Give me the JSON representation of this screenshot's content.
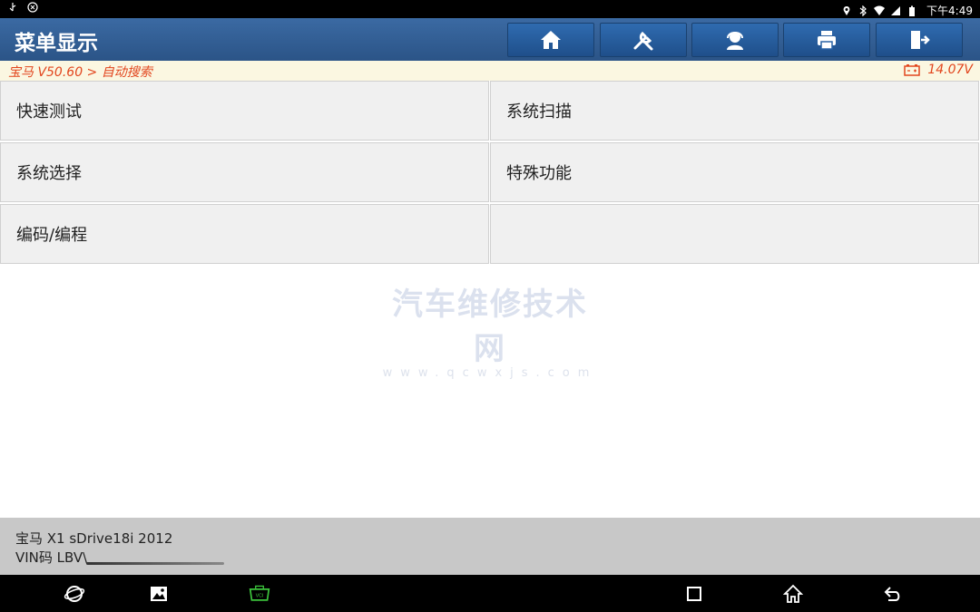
{
  "status_bar": {
    "clock": "下午4:49",
    "left_icons": [
      "usb-icon",
      "android-debug-icon"
    ],
    "right_icons": [
      "location-icon",
      "bluetooth-icon",
      "wifi-icon",
      "signal-icon",
      "battery-icon"
    ]
  },
  "header": {
    "title": "菜单显示",
    "buttons": [
      "home-icon",
      "diagnostic-tool-icon",
      "support-agent-icon",
      "print-icon",
      "exit-icon"
    ],
    "colors": {
      "background": "#2f5c94",
      "button": "#2a63a6"
    }
  },
  "breadcrumb": {
    "path": "宝马 V50.60 > 自动搜索",
    "voltage": "14.07V",
    "colors": {
      "text": "#e2461e",
      "background": "#fbf7e1"
    }
  },
  "menu": {
    "items": [
      {
        "label": "快速测试"
      },
      {
        "label": "系统扫描"
      },
      {
        "label": "系统选择"
      },
      {
        "label": "特殊功能"
      },
      {
        "label": "编码/编程"
      },
      {
        "label": ""
      }
    ]
  },
  "watermark": {
    "main": "汽车维修技术网",
    "url": "www.qcwxjs.com"
  },
  "vehicle": {
    "model": "宝马 X1 sDrive18i 2012",
    "vin": "VIN码 LBV\\"
  },
  "nav_bar": {
    "icons": [
      "browser-icon",
      "gallery-icon",
      "vci-icon",
      "recent-apps-icon",
      "home-nav-icon",
      "back-icon"
    ],
    "vci_color": "#3cc63c"
  }
}
